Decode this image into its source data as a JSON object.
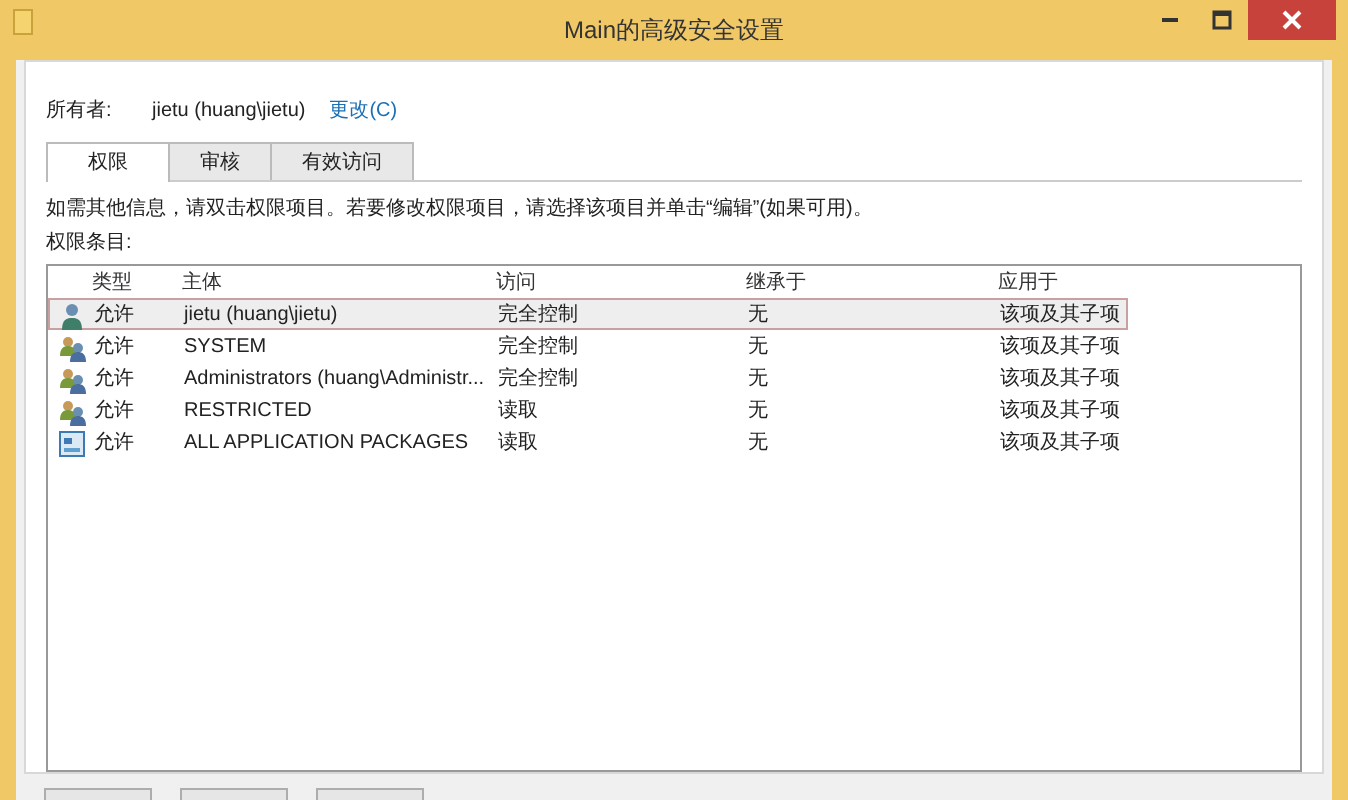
{
  "window": {
    "title": "Main的高级安全设置"
  },
  "owner": {
    "label": "所有者:",
    "value": "jietu (huang\\jietu)",
    "change_link": "更改(C)"
  },
  "tabs": [
    {
      "label": "权限",
      "selected": true
    },
    {
      "label": "审核",
      "selected": false
    },
    {
      "label": "有效访问",
      "selected": false
    }
  ],
  "info_text": "如需其他信息，请双击权限项目。若要修改权限项目，请选择该项目并单击“编辑”(如果可用)。",
  "list_label": "权限条目:",
  "table": {
    "columns": [
      "类型",
      "主体",
      "访问",
      "继承于",
      "应用于"
    ],
    "rows": [
      {
        "kind": "user",
        "type": "允许",
        "principal": "jietu (huang\\jietu)",
        "access": "完全控制",
        "inherited_from": "无",
        "applies_to": "该项及其子项",
        "selected": true
      },
      {
        "kind": "group",
        "type": "允许",
        "principal": "SYSTEM",
        "access": "完全控制",
        "inherited_from": "无",
        "applies_to": "该项及其子项",
        "selected": false
      },
      {
        "kind": "group",
        "type": "允许",
        "principal": "Administrators (huang\\Administr...",
        "access": "完全控制",
        "inherited_from": "无",
        "applies_to": "该项及其子项",
        "selected": false
      },
      {
        "kind": "group",
        "type": "允许",
        "principal": "RESTRICTED",
        "access": "读取",
        "inherited_from": "无",
        "applies_to": "该项及其子项",
        "selected": false
      },
      {
        "kind": "package",
        "type": "允许",
        "principal": "ALL APPLICATION PACKAGES",
        "access": "读取",
        "inherited_from": "无",
        "applies_to": "该项及其子项",
        "selected": false
      }
    ]
  }
}
